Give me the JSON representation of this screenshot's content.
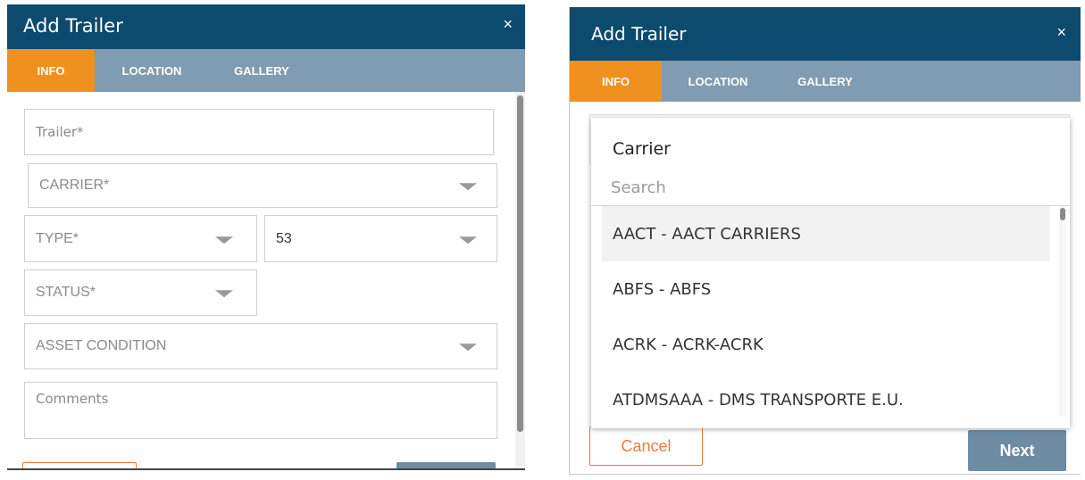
{
  "left": {
    "title": "Add Trailer",
    "close": "×",
    "tabs": [
      {
        "label": "INFO",
        "active": true
      },
      {
        "label": "LOCATION",
        "active": false
      },
      {
        "label": "GALLERY",
        "active": false
      }
    ],
    "fields": {
      "trailer_placeholder": "Trailer*",
      "carrier": "CARRIER*",
      "type": "TYPE*",
      "length": "53",
      "status": "STATUS*",
      "asset_condition": "ASSET CONDITION",
      "comments_placeholder": "Comments"
    }
  },
  "right": {
    "title": "Add Trailer",
    "close": "×",
    "tabs": [
      {
        "label": "INFO",
        "active": true
      },
      {
        "label": "LOCATION",
        "active": false
      },
      {
        "label": "GALLERY",
        "active": false
      }
    ],
    "dropdown": {
      "title": "Carrier",
      "search_placeholder": "Search",
      "items": [
        {
          "label": "AACT - AACT CARRIERS",
          "highlighted": true
        },
        {
          "label": "ABFS - ABFS",
          "highlighted": false
        },
        {
          "label": "ACRK - ACRK-ACRK",
          "highlighted": false
        },
        {
          "label": "ATDMSAAA - DMS TRANSPORTE E.U.",
          "highlighted": false
        }
      ]
    },
    "buttons": {
      "cancel": "Cancel",
      "next": "Next"
    }
  },
  "colors": {
    "header": "#0c4a6e",
    "tabbar": "#7f9cb3",
    "active_tab": "#f0901e",
    "cancel_accent": "#f07a3c",
    "next_button": "#6d8ca4"
  }
}
